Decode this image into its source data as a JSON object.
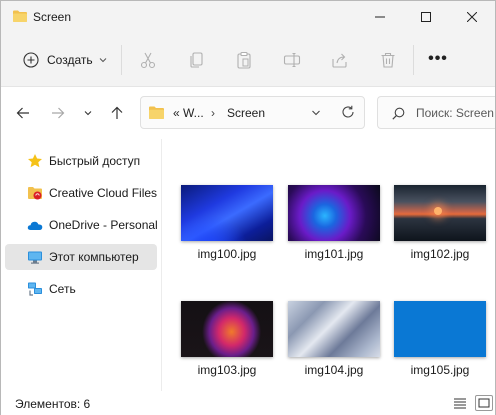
{
  "window": {
    "title": "Screen"
  },
  "commandbar": {
    "create_label": "Создать",
    "icons": [
      "scissors-icon",
      "copy-icon",
      "paste-icon",
      "rename-icon",
      "share-icon",
      "delete-icon"
    ],
    "more_label": "•••"
  },
  "navbar": {
    "address_prefix": "« W...",
    "address_arrow": "›",
    "address_current": "Screen",
    "search_placeholder": "Поиск: Screen"
  },
  "sidebar": {
    "items": [
      {
        "label": "Быстрый доступ",
        "icon": "star-icon"
      },
      {
        "label": "Creative Cloud Files",
        "icon": "creative-cloud-icon"
      },
      {
        "label": "OneDrive - Personal",
        "icon": "onedrive-cloud-icon"
      },
      {
        "label": "Этот компьютер",
        "icon": "computer-icon"
      },
      {
        "label": "Сеть",
        "icon": "network-icon"
      }
    ],
    "selected_index": 3
  },
  "files": [
    {
      "name": "img100.jpg"
    },
    {
      "name": "img101.jpg"
    },
    {
      "name": "img102.jpg"
    },
    {
      "name": "img103.jpg"
    },
    {
      "name": "img104.jpg"
    },
    {
      "name": "img105.jpg"
    }
  ],
  "statusbar": {
    "count_text": "Элементов: 6"
  },
  "colors": {
    "accent": "#0a78d4",
    "folder": "#f0c040",
    "chrome": "#f3f3f3"
  }
}
